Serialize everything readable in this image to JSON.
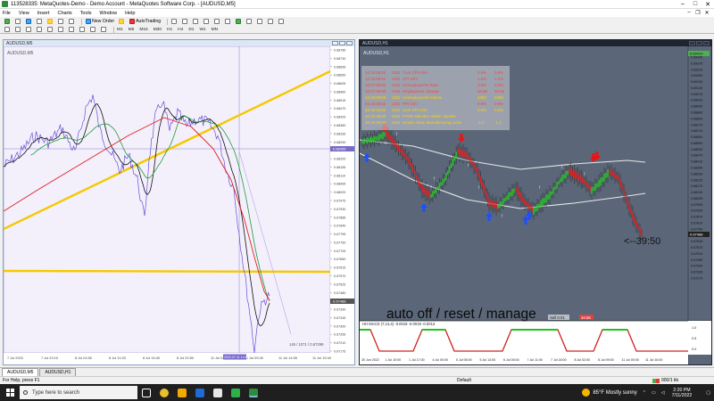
{
  "window": {
    "title": "113528335: MetaQuotes-Demo - Demo Account - MetaQuotes Software Corp. - [AUDUSD,M5]"
  },
  "menu": {
    "items": [
      "File",
      "View",
      "Insert",
      "Charts",
      "Tools",
      "Window",
      "Help"
    ]
  },
  "toolbar": {
    "new_order_label": "New Order",
    "autotrading_label": "AutoTrading",
    "timeframes": [
      "M1",
      "M5",
      "M15",
      "M30",
      "H1",
      "H4",
      "D1",
      "W1",
      "MN"
    ]
  },
  "left_chart": {
    "caption": "AUDUSD,M5",
    "symbol_label": "AUDUSD,M5",
    "colors": {
      "background": "#f3f0fb",
      "price": "#6a4fd8",
      "yellow": "#f5c800",
      "red": "#e02020",
      "green": "#1d9a3a"
    },
    "price_ticks": [
      "0.68785",
      "0.68740",
      "0.68695",
      "0.68650",
      "0.68605",
      "0.68560",
      "0.68515",
      "0.68470",
      "0.68425",
      "0.68380",
      "0.68335",
      "0.68290",
      "0.68245",
      "0.68200",
      "0.68155",
      "0.68110",
      "0.68065",
      "0.68020",
      "0.67975",
      "0.67930",
      "0.67885",
      "0.67840",
      "0.67795",
      "0.67750",
      "0.67705",
      "0.67660",
      "0.67615",
      "0.67570",
      "0.67525",
      "0.67480",
      "0.67435",
      "0.67390",
      "0.67345",
      "0.67300",
      "0.67255",
      "0.67210",
      "0.67175"
    ],
    "current_price_label": "0.68455",
    "bid_label": "0.67488",
    "time_ticks": [
      "7 Jul 2022",
      "7 Jul 23:10",
      "8 Jul 04:50",
      "8 Jul 10:20",
      "8 Jul 15:40",
      "8 Jul 20:50",
      "11 Jul 04:20",
      "11 Jul 09:40",
      "11 Jul 14:55",
      "11 Jul 19:40"
    ],
    "crosshair_time_label": "2022.07.11 14:55",
    "crosshair_readout": "145 / 1071 / 0.67299"
  },
  "right_chart": {
    "caption": "AUDUSD,H1",
    "symbol_label": "AUDUSD,H1",
    "colors": {
      "background": "#5b6778",
      "up": "#22c21e",
      "down": "#e01818",
      "band": "#e8e8e8",
      "arrow_up": "#1e4fff",
      "arrow_down": "#ee1111"
    },
    "news": [
      {
        "time": "1d 18:08:50",
        "currency": "USD",
        "event": "Core CPI m/m",
        "forecast": "0.6%",
        "previous": "0.6%",
        "color": "#ff4040"
      },
      {
        "time": "1d 18:08:50",
        "currency": "USD",
        "event": "CPI m/m",
        "forecast": "1.0%",
        "previous": "1.1%",
        "color": "#ff4040"
      },
      {
        "time": "2d 07:08:50",
        "currency": "AUD",
        "event": "Unemployment Rate",
        "forecast": "3.9%",
        "previous": "3.8%",
        "color": "#ff4040"
      },
      {
        "time": "2d 07:08:50",
        "currency": "AUD",
        "event": "Employment Change",
        "forecast": "60.9K",
        "previous": "30.0K",
        "color": "#ff4040"
      },
      {
        "time": "2d 18:08:50",
        "currency": "USD",
        "event": "Unemployment Claims",
        "forecast": "235K",
        "previous": "235K",
        "color": "#ffd000"
      },
      {
        "time": "2d 18:08:50",
        "currency": "USD",
        "event": "PPI m/m",
        "forecast": "0.8%",
        "previous": "0.8%",
        "color": "#ff4040"
      },
      {
        "time": "2d 18:08:50",
        "currency": "USD",
        "event": "Core PPI m/m",
        "forecast": "0.5%",
        "previous": "0.5%",
        "color": "#ffd000"
      },
      {
        "time": "2d 20:38:50",
        "currency": "USD",
        "event": "FOMC Member Waller Speaks",
        "forecast": "",
        "previous": "",
        "color": "#ffd000"
      },
      {
        "time": "3d 18:08:50",
        "currency": "USD",
        "event": "Empire State Manufacturing Index",
        "forecast": "-1.2",
        "previous": "-1.2",
        "color": "#ffd000"
      }
    ],
    "price_ticks": [
      "0.69425",
      "0.69370",
      "0.69310",
      "0.69250",
      "0.69190",
      "0.69130",
      "0.69070",
      "0.69010",
      "0.68950",
      "0.68890",
      "0.68830",
      "0.68770",
      "0.68710",
      "0.68650",
      "0.68590",
      "0.68530",
      "0.68470",
      "0.68410",
      "0.68350",
      "0.68290",
      "0.68230",
      "0.68170",
      "0.68110",
      "0.68050",
      "0.67990",
      "0.67930",
      "0.67870",
      "0.67810",
      "0.67750",
      "0.67690",
      "0.67630",
      "0.67570",
      "0.67510",
      "0.67450",
      "0.67390",
      "0.67330",
      "0.67270"
    ],
    "top_badge": "0.69410",
    "current_price_label": "0.67488",
    "countdown_label": "<--39:50",
    "overlay_text": "auto off / reset / manage",
    "small_label_left": "Sell 0.01",
    "small_label_right": "34.56",
    "indicator_label": "HH MACD (7,14,4) -0.0019 -0.0019 -0.0013",
    "indicator_ticks": [
      "1.0",
      "0.5",
      "0.0"
    ],
    "time_ticks": [
      "30 Jun 2022",
      "1 Jul 10:00",
      "1 Jul 17:00",
      "4 Jul 00:00",
      "5 Jul 06:00",
      "5 Jul 13:00",
      "6 Jul 05:00",
      "7 Jul 11:00",
      "7 Jul 18:00",
      "8 Jul 02:00",
      "8 Jul 09:00",
      "11 Jul 00:00",
      "11 Jul 16:00"
    ]
  },
  "tabs": [
    "AUDUSD,M5",
    "AUDUSD,H1"
  ],
  "status": {
    "help": "For Help, press F1",
    "profile": "Default",
    "traffic": "900/1 kb"
  },
  "taskbar": {
    "search_placeholder": "Type here to search",
    "weather": "85°F  Mostly sunny",
    "time": "2:20 PM",
    "date": "7/11/2022",
    "icon_colors": [
      "#ffffff",
      "#2b7bff",
      "#f2a900",
      "#1f6bd6",
      "#e6e6e6",
      "#2fb14a",
      "#2e8b3d"
    ]
  }
}
